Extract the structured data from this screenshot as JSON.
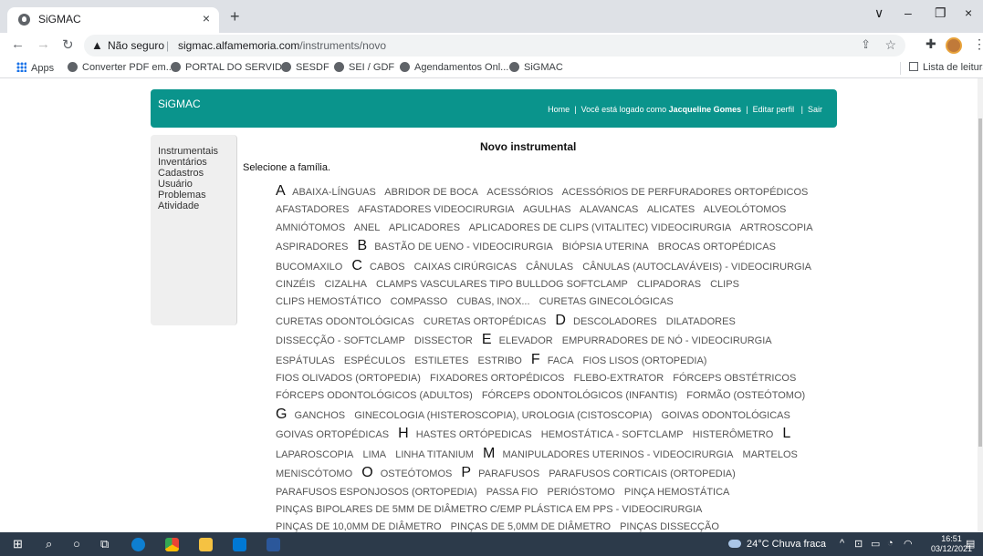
{
  "browser": {
    "tab_title": "SiGMAC",
    "tab_close": "×",
    "new_tab": "+",
    "window_controls": [
      "∨",
      "–",
      "❐",
      "×"
    ],
    "security": "Não seguro",
    "url_host": "sigmac.alfamemoria.com",
    "url_path": "/instruments/novo",
    "bookmarks": [
      "Apps",
      "Converter PDF em...",
      "PORTAL DO SERVID...",
      "SESDF",
      "SEI / GDF",
      "Agendamentos Onl...",
      "SiGMAC"
    ],
    "reading_list": "Lista de leitura"
  },
  "header": {
    "brand": "SiGMAC",
    "home": "Home",
    "logged_prefix": "Você está logado como",
    "user": "Jacqueline Gomes",
    "edit_profile": "Editar perfil",
    "logout": "Sair",
    "separator": "|"
  },
  "sidebar": {
    "items": [
      "Instrumentais",
      "Inventários",
      "Cadastros",
      "Usuário",
      "Problemas",
      "Atividade"
    ]
  },
  "main": {
    "title": "Novo instrumental",
    "select_label": "Selecione a família."
  },
  "families": [
    {
      "letter": "A"
    },
    {
      "name": "ABAIXA-LÍNGUAS"
    },
    {
      "name": "ABRIDOR DE BOCA"
    },
    {
      "name": "ACESSÓRIOS"
    },
    {
      "name": "ACESSÓRIOS DE PERFURADORES ORTOPÉDICOS"
    },
    {
      "name": "AFASTADORES"
    },
    {
      "name": "AFASTADORES VIDEOCIRURGIA"
    },
    {
      "name": "AGULHAS"
    },
    {
      "name": "ALAVANCAS"
    },
    {
      "name": "ALICATES"
    },
    {
      "name": "ALVEOLÓTOMOS"
    },
    {
      "name": "AMNIÓTOMOS"
    },
    {
      "name": "ANEL"
    },
    {
      "name": "APLICADORES"
    },
    {
      "name": "APLICADORES DE CLIPS (VITALITEC) VIDEOCIRURGIA"
    },
    {
      "name": "ARTROSCOPIA"
    },
    {
      "name": "ASPIRADORES"
    },
    {
      "letter": "B"
    },
    {
      "name": "BASTÃO DE UENO - VIDEOCIRURGIA"
    },
    {
      "name": "BIÓPSIA UTERINA"
    },
    {
      "name": "BROCAS ORTOPÉDICAS"
    },
    {
      "name": "BUCOMAXILO"
    },
    {
      "letter": "C"
    },
    {
      "name": "CABOS"
    },
    {
      "name": "CAIXAS CIRÚRGICAS"
    },
    {
      "name": "CÂNULAS"
    },
    {
      "name": "CÂNULAS (AUTOCLAVÁVEIS) - VIDEOCIRURGIA"
    },
    {
      "name": "CINZÉIS"
    },
    {
      "name": "CIZALHA"
    },
    {
      "name": "CLAMPS VASCULARES TIPO BULLDOG SOFTCLAMP"
    },
    {
      "name": "CLIPADORAS"
    },
    {
      "name": "CLIPS"
    },
    {
      "name": "CLIPS HEMOSTÁTICO"
    },
    {
      "name": "COMPASSO"
    },
    {
      "name": "CUBAS, INOX..."
    },
    {
      "name": "CURETAS GINECOLÓGICAS"
    },
    {
      "name": "CURETAS ODONTOLÓGICAS"
    },
    {
      "name": "CURETAS ORTOPÉDICAS"
    },
    {
      "letter": "D"
    },
    {
      "name": "DESCOLADORES"
    },
    {
      "name": "DILATADORES"
    },
    {
      "name": "DISSECÇÃO - SOFTCLAMP"
    },
    {
      "name": "DISSECTOR"
    },
    {
      "letter": "E"
    },
    {
      "name": "ELEVADOR"
    },
    {
      "name": "EMPURRADORES DE NÓ - VIDEOCIRURGIA"
    },
    {
      "name": "ESPÁTULAS"
    },
    {
      "name": "ESPÉCULOS"
    },
    {
      "name": "ESTILETES"
    },
    {
      "name": "ESTRIBO"
    },
    {
      "letter": "F"
    },
    {
      "name": "FACA"
    },
    {
      "name": "FIOS LISOS (ORTOPEDIA)"
    },
    {
      "name": "FIOS OLIVADOS (ORTOPEDIA)"
    },
    {
      "name": "FIXADORES ORTOPÉDICOS"
    },
    {
      "name": "FLEBO-EXTRATOR"
    },
    {
      "name": "FÓRCEPS OBSTÉTRICOS"
    },
    {
      "name": "FÓRCEPS ODONTOLÓGICOS (ADULTOS)"
    },
    {
      "name": "FÓRCEPS ODONTOLÓGICOS (INFANTIS)"
    },
    {
      "name": "FORMÃO (OSTEÓTOMO)"
    },
    {
      "letter": "G"
    },
    {
      "name": "GANCHOS"
    },
    {
      "name": "GINECOLOGIA (HISTEROSCOPIA), UROLOGIA (CISTOSCOPIA)"
    },
    {
      "name": "GOIVAS ODONTOLÓGICAS"
    },
    {
      "name": "GOIVAS ORTOPÉDICAS"
    },
    {
      "letter": "H"
    },
    {
      "name": "HASTES ORTÓPEDICAS"
    },
    {
      "name": "HEMOSTÁTICA - SOFTCLAMP"
    },
    {
      "name": "HISTERÔMETRO"
    },
    {
      "letter": "L"
    },
    {
      "name": "LAPAROSCOPIA"
    },
    {
      "name": "LIMA"
    },
    {
      "name": "LINHA TITANIUM"
    },
    {
      "letter": "M"
    },
    {
      "name": "MANIPULADORES UTERINOS - VIDEOCIRURGIA"
    },
    {
      "name": "MARTELOS"
    },
    {
      "name": "MENISCÓTOMO"
    },
    {
      "letter": "O"
    },
    {
      "name": "OSTEÓTOMOS"
    },
    {
      "letter": "P"
    },
    {
      "name": "PARAFUSOS"
    },
    {
      "name": "PARAFUSOS CORTICAIS (ORTOPEDIA)"
    },
    {
      "name": "PARAFUSOS ESPONJOSOS (ORTOPEDIA)"
    },
    {
      "name": "PASSA FIO"
    },
    {
      "name": "PERIÓSTOMO"
    },
    {
      "name": "PINÇA HEMOSTÁTICA"
    },
    {
      "name": "PINÇAS BIPOLARES DE 5MM DE DIÂMETRO C/EMP PLÁSTICA EM PPS - VIDEOCIRURGIA"
    },
    {
      "name": "PINÇAS DE 10,0MM DE DIÂMETRO"
    },
    {
      "name": "PINÇAS DE 5,0MM DE DIÂMETRO"
    },
    {
      "name": "PINÇAS DISSECÇÃO"
    }
  ],
  "taskbar": {
    "weather": "24°C  Chuva fraca",
    "time": "16:51",
    "date": "03/12/2021",
    "tray_caret": "^"
  }
}
